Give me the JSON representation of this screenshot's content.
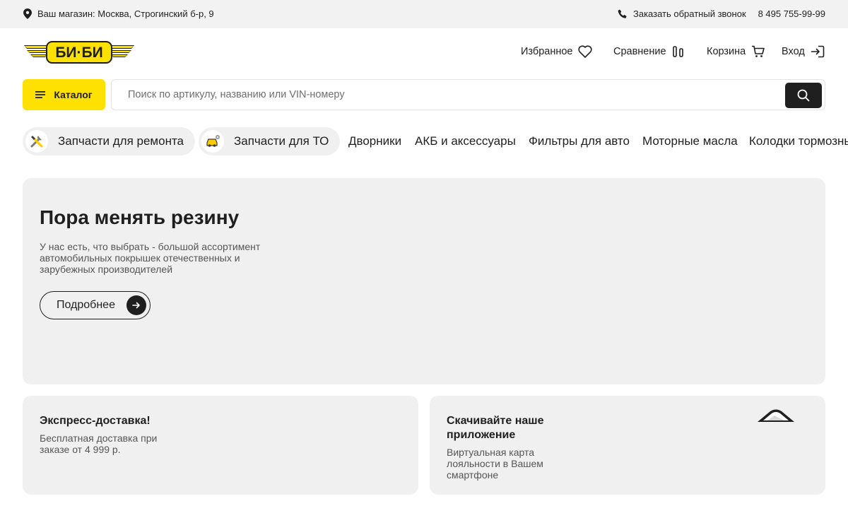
{
  "topbar": {
    "store": "Ваш магазин: Москва, Строгинский б-р, 9",
    "callback": "Заказать обратный звонок",
    "phone": "8 495 755-99-99"
  },
  "header": {
    "logo_text": "БИ·БИ",
    "favorites": "Избранное",
    "compare": "Сравнение",
    "cart": "Корзина",
    "login": "Вход"
  },
  "catalog": {
    "label": "Каталог"
  },
  "search": {
    "placeholder": "Поиск по артикулу, названию или VIN-номеру",
    "value": ""
  },
  "categories": {
    "chips": [
      {
        "label": "Запчасти для ремонта",
        "icon": "wrench-screwdriver-icon"
      },
      {
        "label": "Запчасти для ТО",
        "icon": "car-service-icon"
      }
    ],
    "links": [
      "Дворники",
      "АКБ и аксессуары",
      "Фильтры для авто",
      "Моторные масла",
      "Колодки тормозные"
    ]
  },
  "hero": {
    "title": "Пора менять резину",
    "text": "У нас есть, что выбрать - большой ассортимент автомобильных покрышек отечественных и зарубежных производителей",
    "button": "Подробнее"
  },
  "cards": [
    {
      "title": "Экспресс-доставка!",
      "text": "Бесплатная доставка при заказе от 4 999 р."
    },
    {
      "title": "Скачивайте наше приложение",
      "text": "Виртуальная карта лояльности в Вашем смартфоне"
    }
  ],
  "colors": {
    "brand_yellow": "#ffe100",
    "dark": "#1f1f1f",
    "panel": "#f0f0f0",
    "topbar": "#f2f2f2"
  }
}
